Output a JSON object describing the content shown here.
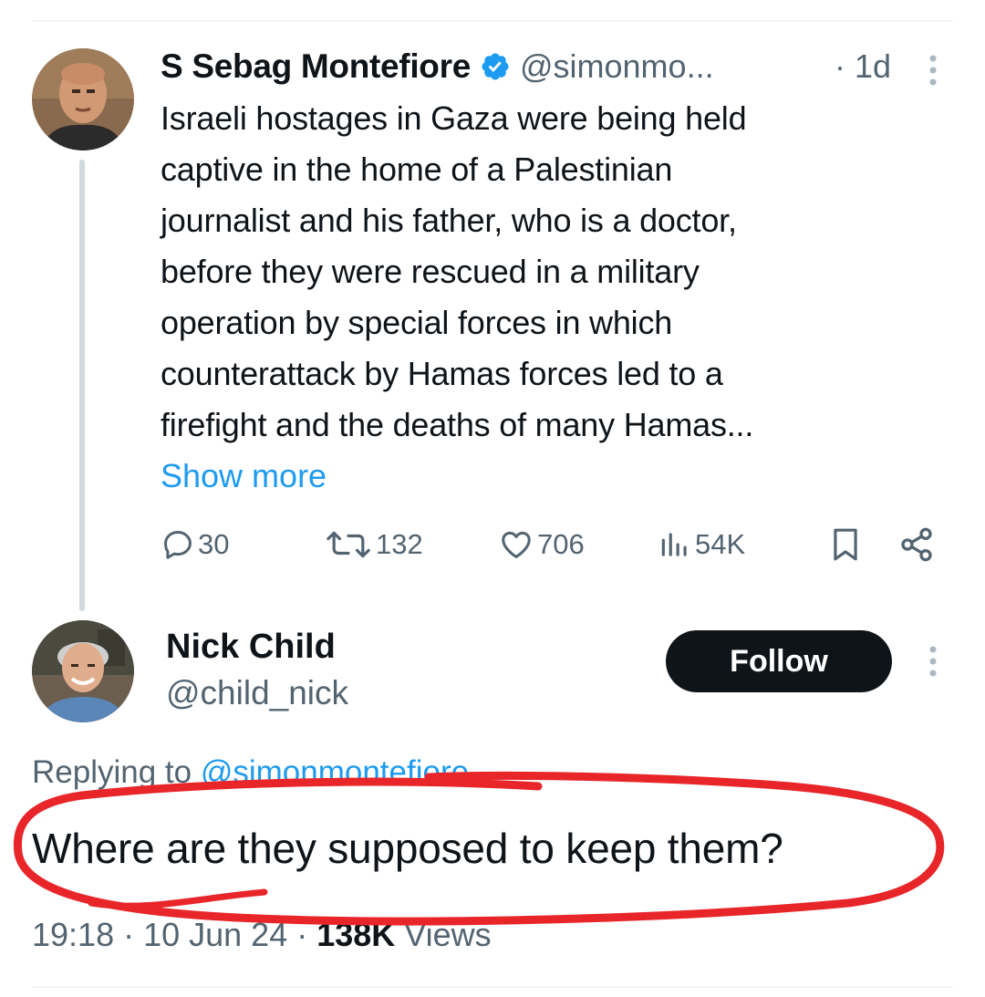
{
  "parent_tweet": {
    "author_name": "S Sebag Montefiore",
    "handle": "@simonmo...",
    "time": "· 1d",
    "text_lines": [
      "Israeli hostages in Gaza were being held",
      "captive in the home of a Palestinian",
      "journalist and his father, who is a doctor,",
      "before they were rescued in a military",
      "operation by special forces in which",
      "counterattack by Hamas forces led to a",
      "firefight and the deaths of many Hamas..."
    ],
    "show_more": "Show more",
    "actions": {
      "replies": "30",
      "retweets": "132",
      "likes": "706",
      "views": "54K"
    }
  },
  "reply_tweet": {
    "author_name": "Nick Child",
    "handle": "@child_nick",
    "follow_label": "Follow",
    "replying_prefix": "Replying to ",
    "replying_to": "@simonmontefiore",
    "text": "Where are they supposed to keep them?",
    "time": "19:18 · 10 Jun 24 · ",
    "views_count": "138K",
    "views_label": " Views"
  },
  "colors": {
    "accent": "#1d9bf0",
    "text_primary": "#0f1419",
    "text_secondary": "#536471",
    "annotation_circle": "#e8262a"
  },
  "icons": {
    "verified": "verified-badge-icon",
    "more": "more-options-icon",
    "reply": "reply-icon",
    "retweet": "retweet-icon",
    "like": "heart-icon",
    "views": "views-chart-icon",
    "bookmark": "bookmark-icon",
    "share": "share-icon"
  }
}
